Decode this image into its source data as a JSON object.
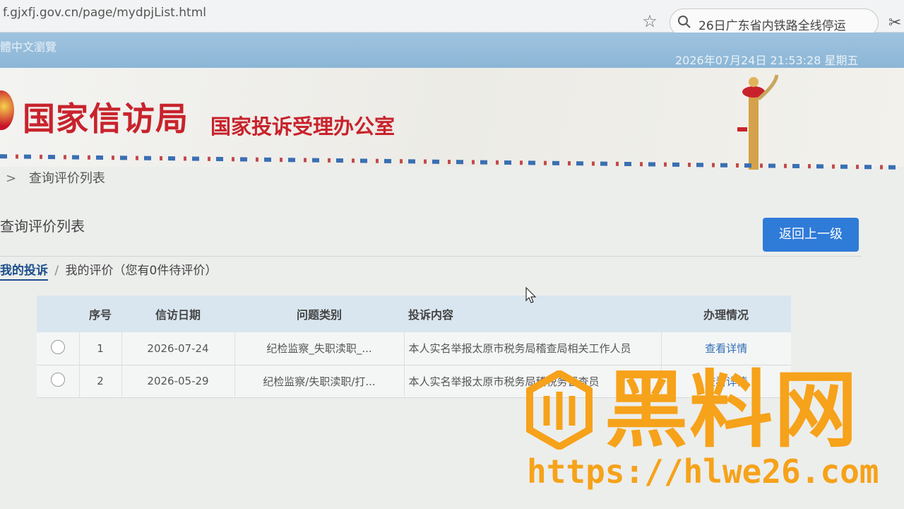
{
  "browser": {
    "url": "f.gjxfj.gov.cn/page/mydpjList.html",
    "search_text": "26日广东省内铁路全线停运",
    "icons": [
      "star-icon",
      "search-icon",
      "scissors-icon"
    ]
  },
  "top_strip": {
    "lang_link": "體中文瀏覽",
    "datetime": "2026年07月24日  21:53:28  星期五"
  },
  "banner": {
    "org_name": "国家信访局",
    "org_sub": "国家投诉受理办公室"
  },
  "breadcrumb": {
    "separator": ">",
    "current": "查询评价列表"
  },
  "section": {
    "title": "查询评价列表",
    "back_button": "返回上一级"
  },
  "tabs": {
    "active": "我的投诉",
    "separator": "/",
    "other": "我的评价（您有0件待评价）"
  },
  "table": {
    "headers": {
      "seq": "序号",
      "date": "信访日期",
      "type": "问题类别",
      "content": "投诉内容",
      "status": "办理情况"
    },
    "rows": [
      {
        "seq": "1",
        "date": "2026-07-24",
        "type": "纪检监察_失职渎职_...",
        "content": "本人实名举报太原市税务局稽查局相关工作人员",
        "status": "查看详情"
      },
      {
        "seq": "2",
        "date": "2026-05-29",
        "type": "纪检监察/失职渎职/打...",
        "content": "本人实名举报太原市税务局稽税务督查员",
        "status": "查看详情"
      }
    ]
  },
  "watermark": {
    "title": "黑料网",
    "url": "https://hlwe26.com"
  },
  "colors": {
    "banner_red": "#c8232c",
    "button_blue": "#2f7bd8",
    "watermark_orange": "#f6a21a",
    "strip_blue": "#8cb6d6"
  }
}
